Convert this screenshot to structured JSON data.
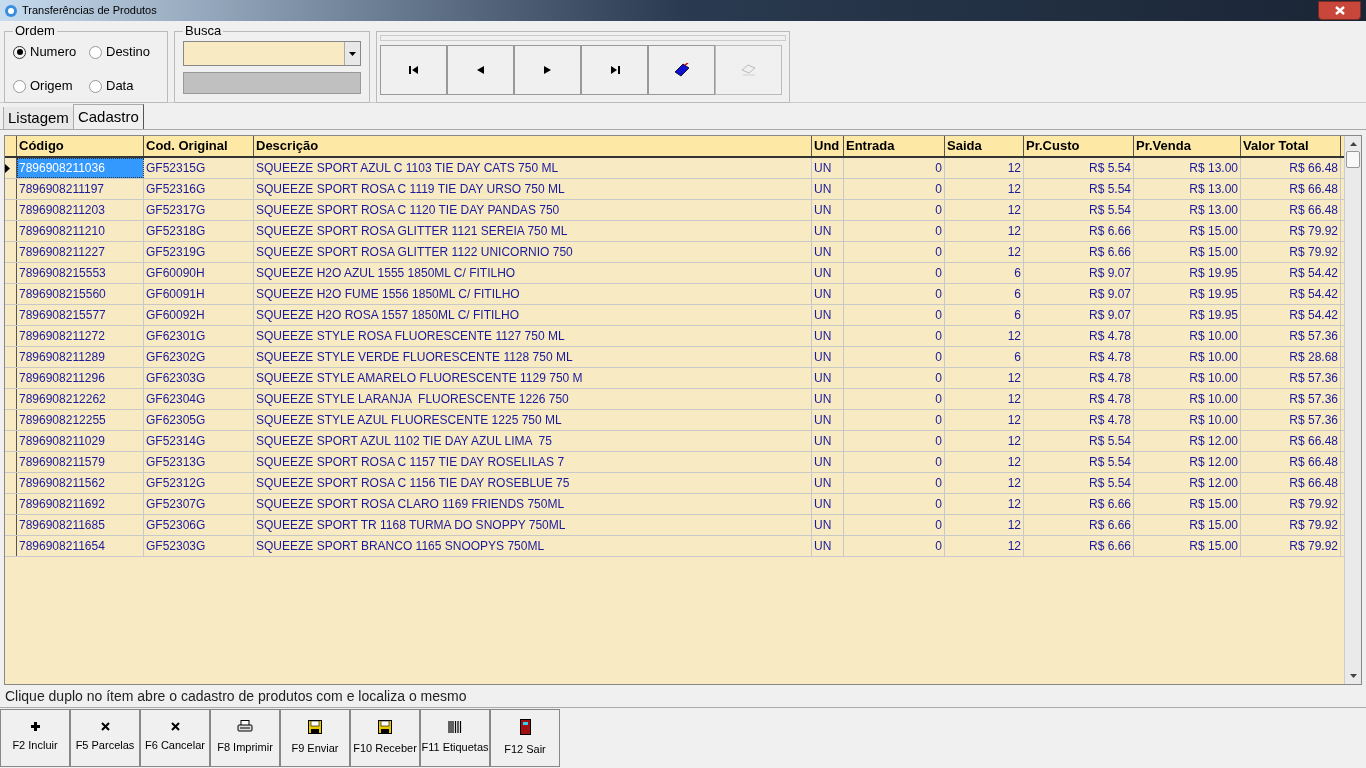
{
  "window": {
    "title": "Transferências de Produtos"
  },
  "ordem": {
    "title": "Ordem",
    "options": [
      {
        "label": "Numero",
        "selected": true
      },
      {
        "label": "Destino",
        "selected": false
      },
      {
        "label": "Origem",
        "selected": false
      },
      {
        "label": "Data",
        "selected": false
      }
    ]
  },
  "busca": {
    "title": "Busca"
  },
  "navigator": [
    {
      "kind": "first",
      "disabled": false
    },
    {
      "kind": "prev",
      "disabled": false
    },
    {
      "kind": "next",
      "disabled": false
    },
    {
      "kind": "last",
      "disabled": false
    },
    {
      "kind": "bookmark",
      "disabled": false
    },
    {
      "kind": "goto",
      "disabled": true
    }
  ],
  "tabs": [
    {
      "label": "Listagem",
      "selected": false
    },
    {
      "label": "Cadastro",
      "selected": true
    }
  ],
  "table": {
    "columns": [
      {
        "label": "Código",
        "kind": "text"
      },
      {
        "label": "Cod. Original",
        "kind": "text"
      },
      {
        "label": "Descrição",
        "kind": "text"
      },
      {
        "label": "Und",
        "kind": "text"
      },
      {
        "label": "Entrada",
        "kind": "number"
      },
      {
        "label": "Saida",
        "kind": "number"
      },
      {
        "label": "Pr.Custo",
        "kind": "number"
      },
      {
        "label": "Pr.Venda",
        "kind": "number"
      },
      {
        "label": "Valor Total",
        "kind": "number"
      }
    ],
    "rows": [
      {
        "selected": true,
        "cells": [
          "7896908211036",
          "GF52315G",
          "SQUEEZE SPORT AZUL C 1103 TIE DAY CATS 750 ML",
          "UN",
          "0",
          "12",
          "R$ 5.54",
          "R$ 13.00",
          "R$ 66.48"
        ]
      },
      {
        "selected": false,
        "cells": [
          "7896908211197",
          "GF52316G",
          "SQUEEZE SPORT ROSA C 1119 TIE DAY URSO 750 ML",
          "UN",
          "0",
          "12",
          "R$ 5.54",
          "R$ 13.00",
          "R$ 66.48"
        ]
      },
      {
        "selected": false,
        "cells": [
          "7896908211203",
          "GF52317G",
          "SQUEEZE SPORT ROSA C 1120 TIE DAY PANDAS 750",
          "UN",
          "0",
          "12",
          "R$ 5.54",
          "R$ 13.00",
          "R$ 66.48"
        ]
      },
      {
        "selected": false,
        "cells": [
          "7896908211210",
          "GF52318G",
          "SQUEEZE SPORT ROSA GLITTER 1121 SEREIA 750 ML",
          "UN",
          "0",
          "12",
          "R$ 6.66",
          "R$ 15.00",
          "R$ 79.92"
        ]
      },
      {
        "selected": false,
        "cells": [
          "7896908211227",
          "GF52319G",
          "SQUEEZE SPORT ROSA GLITTER 1122 UNICORNIO 750",
          "UN",
          "0",
          "12",
          "R$ 6.66",
          "R$ 15.00",
          "R$ 79.92"
        ]
      },
      {
        "selected": false,
        "cells": [
          "7896908215553",
          "GF60090H",
          "SQUEEZE H2O AZUL 1555 1850ML C/ FITILHO",
          "UN",
          "0",
          "6",
          "R$ 9.07",
          "R$ 19.95",
          "R$ 54.42"
        ]
      },
      {
        "selected": false,
        "cells": [
          "7896908215560",
          "GF60091H",
          "SQUEEZE H2O FUME 1556 1850ML C/ FITILHO",
          "UN",
          "0",
          "6",
          "R$ 9.07",
          "R$ 19.95",
          "R$ 54.42"
        ]
      },
      {
        "selected": false,
        "cells": [
          "7896908215577",
          "GF60092H",
          "SQUEEZE H2O ROSA 1557 1850ML C/ FITILHO",
          "UN",
          "0",
          "6",
          "R$ 9.07",
          "R$ 19.95",
          "R$ 54.42"
        ]
      },
      {
        "selected": false,
        "cells": [
          "7896908211272",
          "GF62301G",
          "SQUEEZE STYLE ROSA FLUORESCENTE 1127 750 ML",
          "UN",
          "0",
          "12",
          "R$ 4.78",
          "R$ 10.00",
          "R$ 57.36"
        ]
      },
      {
        "selected": false,
        "cells": [
          "7896908211289",
          "GF62302G",
          "SQUEEZE STYLE VERDE FLUORESCENTE 1128 750 ML",
          "UN",
          "0",
          "6",
          "R$ 4.78",
          "R$ 10.00",
          "R$ 28.68"
        ]
      },
      {
        "selected": false,
        "cells": [
          "7896908211296",
          "GF62303G",
          "SQUEEZE STYLE AMARELO FLUORESCENTE 1129 750 M",
          "UN",
          "0",
          "12",
          "R$ 4.78",
          "R$ 10.00",
          "R$ 57.36"
        ]
      },
      {
        "selected": false,
        "cells": [
          "7896908212262",
          "GF62304G",
          "SQUEEZE STYLE LARANJA  FLUORESCENTE 1226 750",
          "UN",
          "0",
          "12",
          "R$ 4.78",
          "R$ 10.00",
          "R$ 57.36"
        ]
      },
      {
        "selected": false,
        "cells": [
          "7896908212255",
          "GF62305G",
          "SQUEEZE STYLE AZUL FLUORESCENTE 1225 750 ML",
          "UN",
          "0",
          "12",
          "R$ 4.78",
          "R$ 10.00",
          "R$ 57.36"
        ]
      },
      {
        "selected": false,
        "cells": [
          "7896908211029",
          "GF52314G",
          "SQUEEZE SPORT AZUL 1102 TIE DAY AZUL LIMA  75",
          "UN",
          "0",
          "12",
          "R$ 5.54",
          "R$ 12.00",
          "R$ 66.48"
        ]
      },
      {
        "selected": false,
        "cells": [
          "7896908211579",
          "GF52313G",
          "SQUEEZE SPORT ROSA C 1157 TIE DAY ROSELILAS 7",
          "UN",
          "0",
          "12",
          "R$ 5.54",
          "R$ 12.00",
          "R$ 66.48"
        ]
      },
      {
        "selected": false,
        "cells": [
          "7896908211562",
          "GF52312G",
          "SQUEEZE SPORT ROSA C 1156 TIE DAY ROSEBLUE 75",
          "UN",
          "0",
          "12",
          "R$ 5.54",
          "R$ 12.00",
          "R$ 66.48"
        ]
      },
      {
        "selected": false,
        "cells": [
          "7896908211692",
          "GF52307G",
          "SQUEEZE SPORT ROSA CLARO 1169 FRIENDS 750ML",
          "UN",
          "0",
          "12",
          "R$ 6.66",
          "R$ 15.00",
          "R$ 79.92"
        ]
      },
      {
        "selected": false,
        "cells": [
          "7896908211685",
          "GF52306G",
          "SQUEEZE SPORT TR 1168 TURMA DO SNOPPY 750ML",
          "UN",
          "0",
          "12",
          "R$ 6.66",
          "R$ 15.00",
          "R$ 79.92"
        ]
      },
      {
        "selected": false,
        "cells": [
          "7896908211654",
          "GF52303G",
          "SQUEEZE SPORT BRANCO 1165 SNOOPYS 750ML",
          "UN",
          "0",
          "12",
          "R$ 6.66",
          "R$ 15.00",
          "R$ 79.92"
        ]
      }
    ]
  },
  "status_bar": {
    "text": "Clique duplo no ítem abre o cadastro de produtos com e localiza o mesmo"
  },
  "function_buttons": [
    {
      "label": "F2 Incluir",
      "kind": "plus"
    },
    {
      "label": "F5 Parcelas",
      "kind": "cross"
    },
    {
      "label": "F6 Cancelar",
      "kind": "cross"
    },
    {
      "label": "F8 Imprimir",
      "kind": "printer"
    },
    {
      "label": "F9 Enviar",
      "kind": "disk"
    },
    {
      "label": "F10 Receber",
      "kind": "disk"
    },
    {
      "label": "F11 Etiquetas",
      "kind": "barcode"
    },
    {
      "label": "F12 Sair",
      "kind": "door"
    }
  ]
}
